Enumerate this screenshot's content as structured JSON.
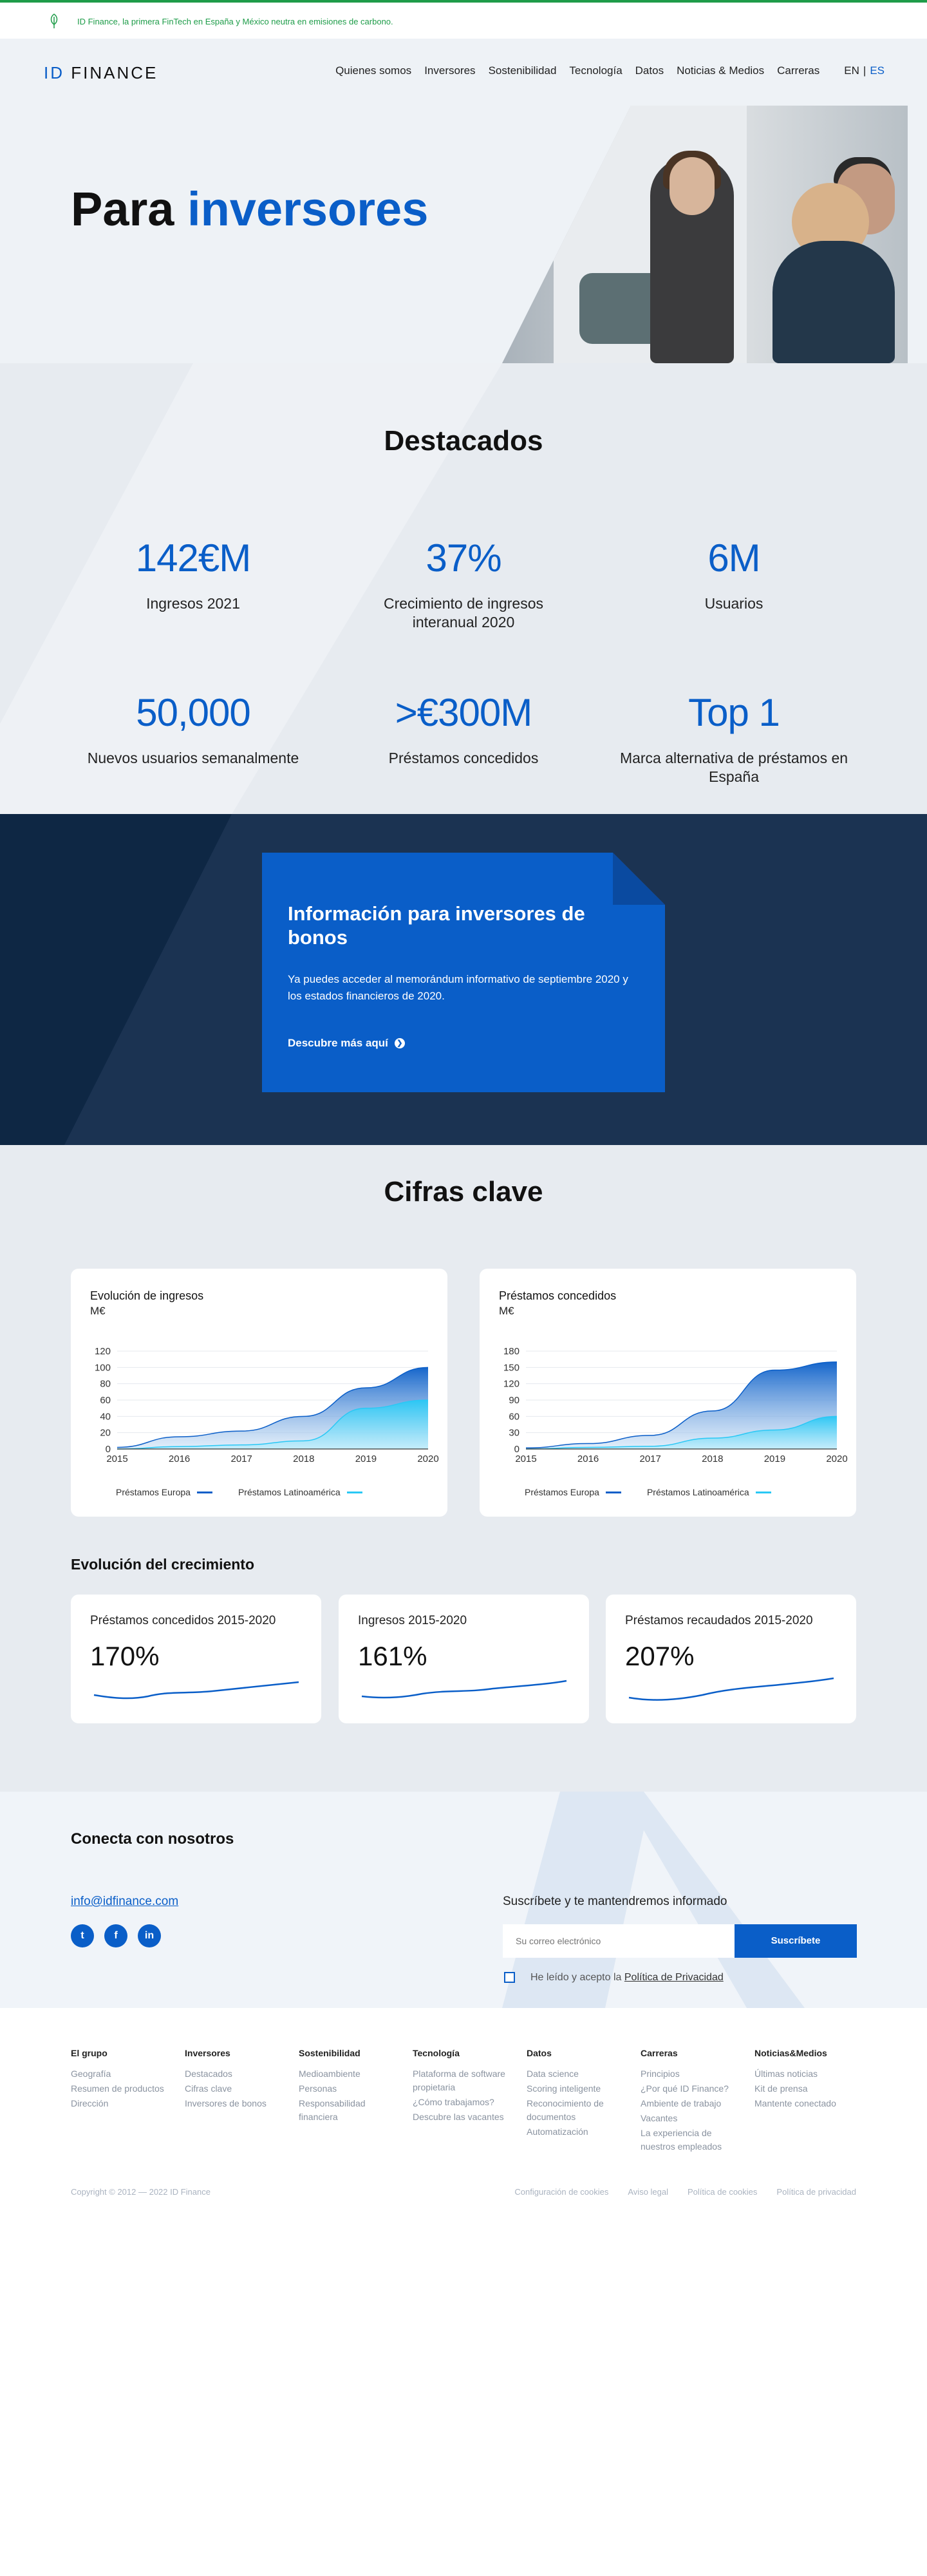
{
  "banner": {
    "text": "ID Finance, la primera FinTech en España y México neutra en emisiones de carbono."
  },
  "logo": {
    "prefix": "ID",
    "name": "FINANCE"
  },
  "nav": {
    "items": [
      "Quienes somos",
      "Inversores",
      "Sostenibilidad",
      "Tecnología",
      "Datos",
      "Noticias & Medios",
      "Carreras"
    ],
    "lang_en": "EN",
    "lang_sep": "|",
    "lang_es": "ES"
  },
  "hero": {
    "title_part1": "Para",
    "title_part2": "inversores"
  },
  "highlights": {
    "title": "Destacados",
    "stats": [
      {
        "value": "142€M",
        "label": "Ingresos 2021"
      },
      {
        "value": "37%",
        "label": "Crecimiento de ingresos interanual 2020"
      },
      {
        "value": "6M",
        "label": "Usuarios"
      },
      {
        "value": "50,000",
        "label": "Nuevos usuarios semanalmente"
      },
      {
        "value": ">€300M",
        "label": "Préstamos concedidos"
      },
      {
        "value": "Top 1",
        "label": "Marca alternativa de préstamos en España"
      }
    ]
  },
  "bonds": {
    "title": "Información para inversores de bonos",
    "text": "Ya puedes acceder al memorándum informativo de septiembre 2020 y los estados financieros de 2020.",
    "cta": "Descubre más aquí",
    "cta_icon": "chevron-right-circle-icon"
  },
  "figures": {
    "title": "Cifras clave",
    "charts": [
      {
        "title": "Evolución de ingresos",
        "unit": "M€"
      },
      {
        "title": "Préstamos concedidos",
        "unit": "M€"
      }
    ],
    "legend": {
      "europe": "Préstamos Europa",
      "latam": "Préstamos Latinoamérica"
    },
    "growth_title": "Evolución del crecimiento",
    "growth": [
      {
        "label": "Préstamos concedidos 2015-2020",
        "value": "170%"
      },
      {
        "label": "Ingresos 2015-2020",
        "value": "161%"
      },
      {
        "label": "Préstamos recaudados 2015-2020",
        "value": "207%"
      }
    ]
  },
  "chart_data": [
    {
      "type": "area",
      "title": "Evolución de ingresos",
      "ylabel": "M€",
      "x": [
        "2015",
        "2016",
        "2017",
        "2018",
        "2019",
        "2020"
      ],
      "ylim": [
        0,
        120
      ],
      "yticks": [
        0,
        20,
        40,
        60,
        80,
        100,
        120
      ],
      "series": [
        {
          "name": "Préstamos Europa",
          "values": [
            2,
            15,
            22,
            40,
            75,
            100
          ],
          "color": "#0a5ec8"
        },
        {
          "name": "Préstamos Latinoamérica",
          "values": [
            0,
            3,
            5,
            10,
            50,
            60
          ],
          "color": "#29c8f5"
        }
      ]
    },
    {
      "type": "area",
      "title": "Préstamos concedidos",
      "ylabel": "M€",
      "x": [
        "2015",
        "2016",
        "2017",
        "2018",
        "2019",
        "2020"
      ],
      "ylim": [
        0,
        180
      ],
      "yticks": [
        0,
        30,
        60,
        90,
        120,
        150,
        180
      ],
      "series": [
        {
          "name": "Préstamos Europa",
          "values": [
            2,
            10,
            25,
            70,
            145,
            160
          ],
          "color": "#0a5ec8"
        },
        {
          "name": "Préstamos Latinoamérica",
          "values": [
            0,
            3,
            5,
            20,
            35,
            60
          ],
          "color": "#29c8f5"
        }
      ]
    }
  ],
  "connect": {
    "title": "Conecta con nosotros",
    "email_link": "info@idfinance.com",
    "socials": [
      "twitter-icon",
      "facebook-icon",
      "linkedin-icon"
    ],
    "subscribe_title": "Suscríbete y te mantendremos informado",
    "email_placeholder": "Su correo electrónico",
    "subscribe_button": "Suscríbete",
    "consent_prefix": "He leído y acepto la",
    "consent_link": "Política de Privacidad"
  },
  "footer": {
    "columns": [
      {
        "heading": "El grupo",
        "links": [
          "Geografía",
          "Resumen de productos",
          "Dirección"
        ]
      },
      {
        "heading": "Inversores",
        "links": [
          "Destacados",
          "Cifras clave",
          "Inversores de bonos"
        ]
      },
      {
        "heading": "Sostenibilidad",
        "links": [
          "Medioambiente",
          "Personas",
          "Responsabilidad financiera"
        ]
      },
      {
        "heading": "Tecnología",
        "links": [
          "Plataforma de software propietaria",
          "¿Cómo trabajamos?",
          "Descubre las vacantes"
        ]
      },
      {
        "heading": "Datos",
        "links": [
          "Data science",
          "Scoring inteligente",
          "Reconocimiento de documentos",
          "Automatización"
        ]
      },
      {
        "heading": "Carreras",
        "links": [
          "Principios",
          "¿Por qué ID Finance?",
          "Ambiente de trabajo",
          "Vacantes",
          "La experiencia de nuestros empleados"
        ]
      },
      {
        "heading": "Noticias&Medios",
        "links": [
          "Últimas noticias",
          "Kit de prensa",
          "Mantente conectado"
        ]
      }
    ],
    "copyright": "Copyright © 2012 — 2022 ID Finance",
    "legal_links": [
      "Configuración de cookies",
      "Aviso legal",
      "Política de cookies",
      "Política de privacidad"
    ]
  },
  "colors": {
    "brand_blue": "#0a5ec8",
    "cyan": "#29c8f5",
    "green": "#1e9c49",
    "navy": "#17304f"
  }
}
